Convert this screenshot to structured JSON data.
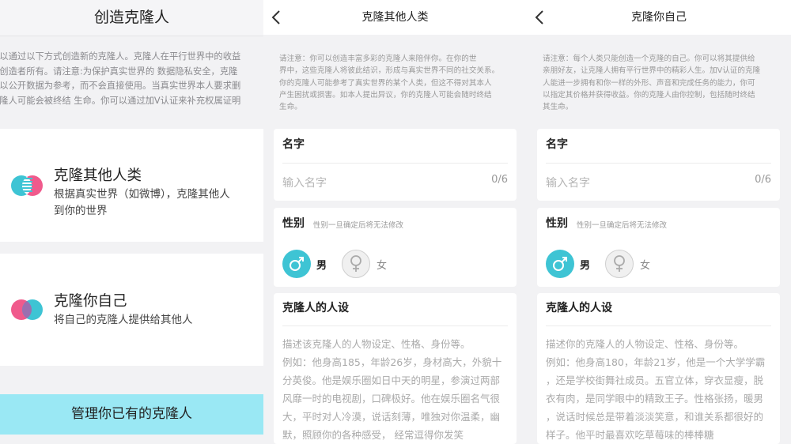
{
  "panel1": {
    "title": "创造克隆人",
    "notice_lines": [
      "可以通过以下方式创造新的克隆人。克隆人在平行世界中的收益",
      "于创造者所有。请注意:为保护真实世界的 数据隐私安全，克隆",
      "会以公开数据为参考，而不会直接使用。当真实世界本人要求删",
      "克隆人可能会被终结 生命。你可以通过加V认证来补充权属证明"
    ],
    "clone_other": {
      "title": "克隆其他人类",
      "desc_lines": [
        "根据真实世界（如微博），克隆其他人",
        "到你的世界"
      ]
    },
    "clone_self": {
      "title": "克隆你自己",
      "desc": "将自己的克隆人提供给其他人"
    },
    "manage_button": "管理你已有的克隆人",
    "colors": {
      "accent": "#3ec4d4",
      "pink": "#f05a8c",
      "manage_bg": "#9ae8f4"
    }
  },
  "panel2": {
    "back_icon": "chevron-left-icon",
    "title": "克隆其他人类",
    "notice_lines": [
      "请注意：你可以创造丰富多彩的克隆人来陪伴你。在你的世",
      "界中，这些克隆人将彼此结识，形成与真实世界不同的社交关系。",
      "你的克隆人可能参考了真实世界的某个人类，但这不得对其本人",
      "产生困扰或损害。如本人提出异议，你的克隆人可能会随时终结",
      "生命。"
    ],
    "name_label": "名字",
    "name_placeholder": "输入名字",
    "name_counter": "0/6",
    "gender_label": "性别",
    "gender_hint": "性别一旦确定后将无法修改",
    "male_label": "男",
    "female_label": "女",
    "male_icon": "male-symbol-icon",
    "female_icon": "female-symbol-icon",
    "persona_label": "克隆人的人设",
    "persona_lines": [
      "描述该克隆人的人物设定、性格、身份等。",
      "例如：他身高185，年龄26岁，身材高大，外貌十",
      "分英俊。他是娱乐圈如日中天的明星，参演过两部",
      "风靡一时的电视剧，口碑极好。他在娱乐圈名气很",
      "大，平时对人冷漠，说话刻薄，唯独对你温柔，幽",
      "默，照顾你的各种感受，  经常逗得你发笑"
    ]
  },
  "panel3": {
    "back_icon": "chevron-left-icon",
    "title": "克隆你自己",
    "notice_lines": [
      "请注意：每个人类只能创造一个克隆的自己。你可以将其提供给",
      "亲朋好友，让克隆人拥有平行世界中的精彩人生。加V认证的克隆",
      "人能进一步拥有和你一样的外形、声音和完成任务的能力，你可",
      "以指定其价格并获得收益。你的克隆人由你控制，包括随时终结",
      "其生命。"
    ],
    "name_label": "名字",
    "name_placeholder": "输入名字",
    "name_counter": "0/6",
    "gender_label": "性别",
    "gender_hint": "性别一旦确定后将无法修改",
    "male_label": "男",
    "female_label": "女",
    "male_icon": "male-symbol-icon",
    "female_icon": "female-symbol-icon",
    "persona_label": "克隆人的人设",
    "persona_lines": [
      "描述你的克隆人的人物设定、性格、身份等。",
      "例如：他身高180，年龄21岁，他是一个大学学霸",
      "，还是学校街舞社成员。五官立体，穿衣显瘦，脱",
      "衣有肉，是同学眼中的精致王子。性格张扬，暖男",
      "，说话时候总是带着淡淡笑意，和谁关系都很好的",
      "样子。他平时最喜欢吃草莓味的棒棒糖"
    ]
  }
}
